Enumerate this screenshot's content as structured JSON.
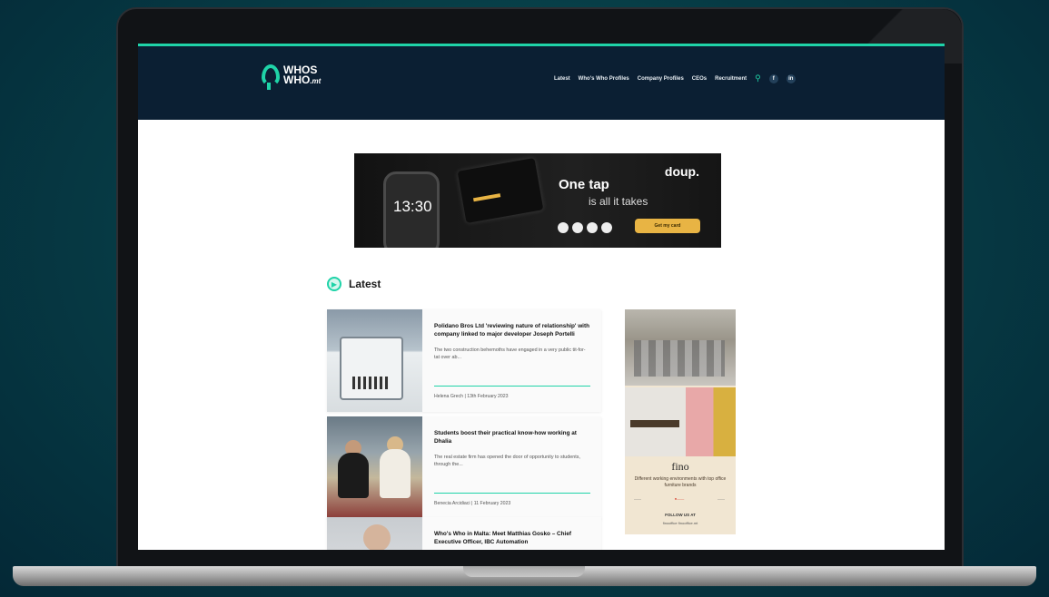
{
  "site": {
    "logo_line1": "WHOS",
    "logo_line2": "WHO",
    "logo_tld": ".mt"
  },
  "nav": {
    "items": [
      "Latest",
      "Who's Who Profiles",
      "Company Profiles",
      "CEOs",
      "Recruitment"
    ],
    "search_icon": "search-icon",
    "social": [
      "f",
      "in"
    ]
  },
  "banner": {
    "brand": "doup.",
    "headline": "One tap",
    "subline": "is all it takes",
    "phone_time": "13:30",
    "cta": "Get my card"
  },
  "section": {
    "title": "Latest"
  },
  "articles": [
    {
      "title": "Polidano Bros Ltd 'reviewing nature of relationship' with company linked to major developer Joseph Portelli",
      "excerpt": "The two construction behemoths have engaged in a very public tit-for-tat over ab...",
      "meta": "Helena Grech | 13th February 2023"
    },
    {
      "title": "Students boost their practical know-how working at Dhalia",
      "excerpt": "The real estate firm has opened the door of opportunity to students, through the...",
      "meta": "Benecia Arcidiaci | 11 February 2023"
    },
    {
      "title": "Who's Who in Malta: Meet Matthias Gosko – Chief Executive Officer, IBC Automation",
      "excerpt": "",
      "meta": ""
    }
  ],
  "side_ad": {
    "brand": "fino",
    "copy": "Different working environments with top office furniture brands",
    "follow": "FOLLOW US AT",
    "handles": "finooffice    finooffice.mt"
  },
  "colors": {
    "accent": "#1fd3a8",
    "nav_bg": "#0b1f33",
    "cta": "#e8b444"
  }
}
